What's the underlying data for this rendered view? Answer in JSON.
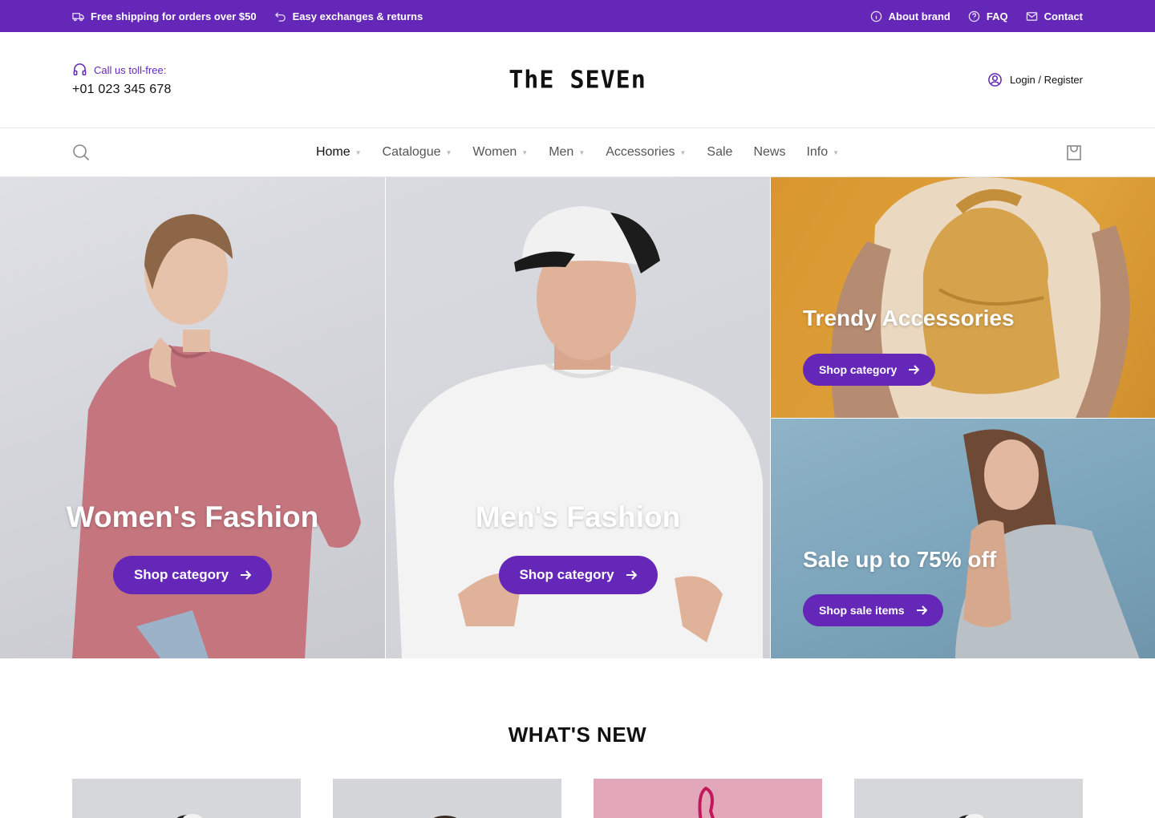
{
  "topbar": {
    "shipping": "Free shipping for orders over $50",
    "exchanges": "Easy exchanges & returns",
    "about": "About brand",
    "faq": "FAQ",
    "contact": "Contact"
  },
  "header": {
    "call_label": "Call us toll-free:",
    "phone": "+01 023 345 678",
    "logo": "ThE SEVEn",
    "login": "Login / Register"
  },
  "nav": {
    "items": [
      {
        "label": "Home",
        "dropdown": true,
        "active": true
      },
      {
        "label": "Catalogue",
        "dropdown": true
      },
      {
        "label": "Women",
        "dropdown": true
      },
      {
        "label": "Men",
        "dropdown": true
      },
      {
        "label": "Accessories",
        "dropdown": true
      },
      {
        "label": "Sale",
        "dropdown": false
      },
      {
        "label": "News",
        "dropdown": false
      },
      {
        "label": "Info",
        "dropdown": true
      }
    ]
  },
  "hero": {
    "women": {
      "title": "Women's Fashion",
      "button": "Shop category"
    },
    "men": {
      "title": "Men's Fashion",
      "button": "Shop category"
    },
    "accessories": {
      "title": "Trendy Accessories",
      "button": "Shop category"
    },
    "sale": {
      "title": "Sale up to 75% off",
      "button": "Shop sale items"
    }
  },
  "whats_new": {
    "title": "WHAT'S NEW"
  },
  "colors": {
    "brand": "#6527b8"
  }
}
